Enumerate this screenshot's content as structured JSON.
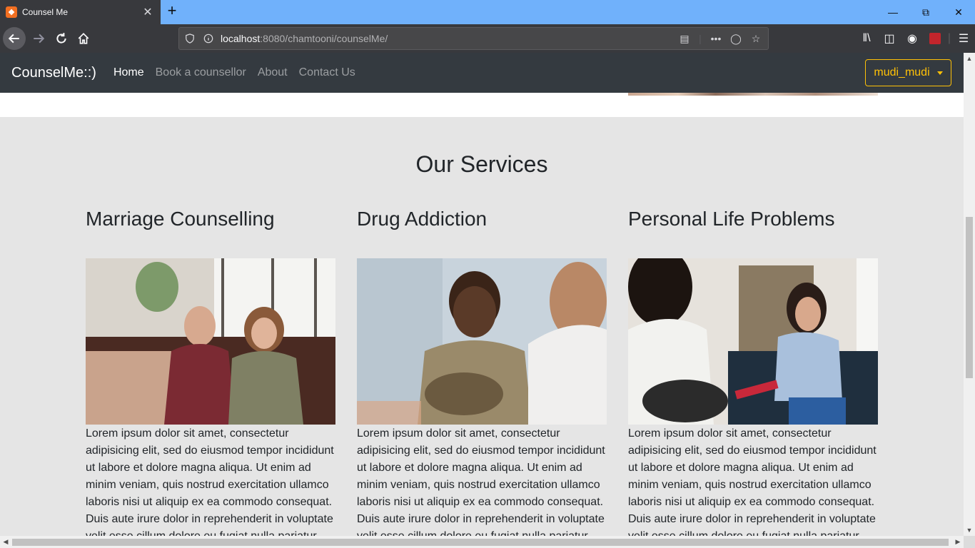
{
  "browser": {
    "tab_title": "Counsel Me",
    "url_host": "localhost",
    "url_rest": ":8080/chamtooni/counselMe/"
  },
  "site": {
    "brand": "CounselMe::)",
    "nav": [
      {
        "label": "Home",
        "active": true
      },
      {
        "label": "Book a counsellor",
        "active": false
      },
      {
        "label": "About",
        "active": false
      },
      {
        "label": "Contact Us",
        "active": false
      }
    ],
    "user_menu": "mudi_mudi"
  },
  "services": {
    "title": "Our Services",
    "items": [
      {
        "heading": "Marriage Counselling",
        "image": "couple-photo",
        "text": "Lorem ipsum dolor sit amet, consectetur adipisicing elit, sed do eiusmod tempor incididunt ut labore et dolore magna aliqua. Ut enim ad minim veniam, quis nostrud exercitation ullamco laboris nisi ut aliquip ex ea commodo consequat. Duis aute irure dolor in reprehenderit in voluptate velit esse cillum dolore eu fugiat nulla pariatur."
      },
      {
        "heading": "Drug Addiction",
        "image": "man-counselling-photo",
        "text": "Lorem ipsum dolor sit amet, consectetur adipisicing elit, sed do eiusmod tempor incididunt ut labore et dolore magna aliqua. Ut enim ad minim veniam, quis nostrud exercitation ullamco laboris nisi ut aliquip ex ea commodo consequat. Duis aute irure dolor in reprehenderit in voluptate velit esse cillum dolore eu fugiat nulla pariatur."
      },
      {
        "heading": "Personal Life Problems",
        "image": "woman-therapy-photo",
        "text": "Lorem ipsum dolor sit amet, consectetur adipisicing elit, sed do eiusmod tempor incididunt ut labore et dolore magna aliqua. Ut enim ad minim veniam, quis nostrud exercitation ullamco laboris nisi ut aliquip ex ea commodo consequat. Duis aute irure dolor in reprehenderit in voluptate velit esse cillum dolore eu fugiat nulla pariatur."
      }
    ]
  },
  "colors": {
    "navbar_bg": "#343a40",
    "accent": "#ffc107",
    "section_bg": "#e5e5e5"
  }
}
